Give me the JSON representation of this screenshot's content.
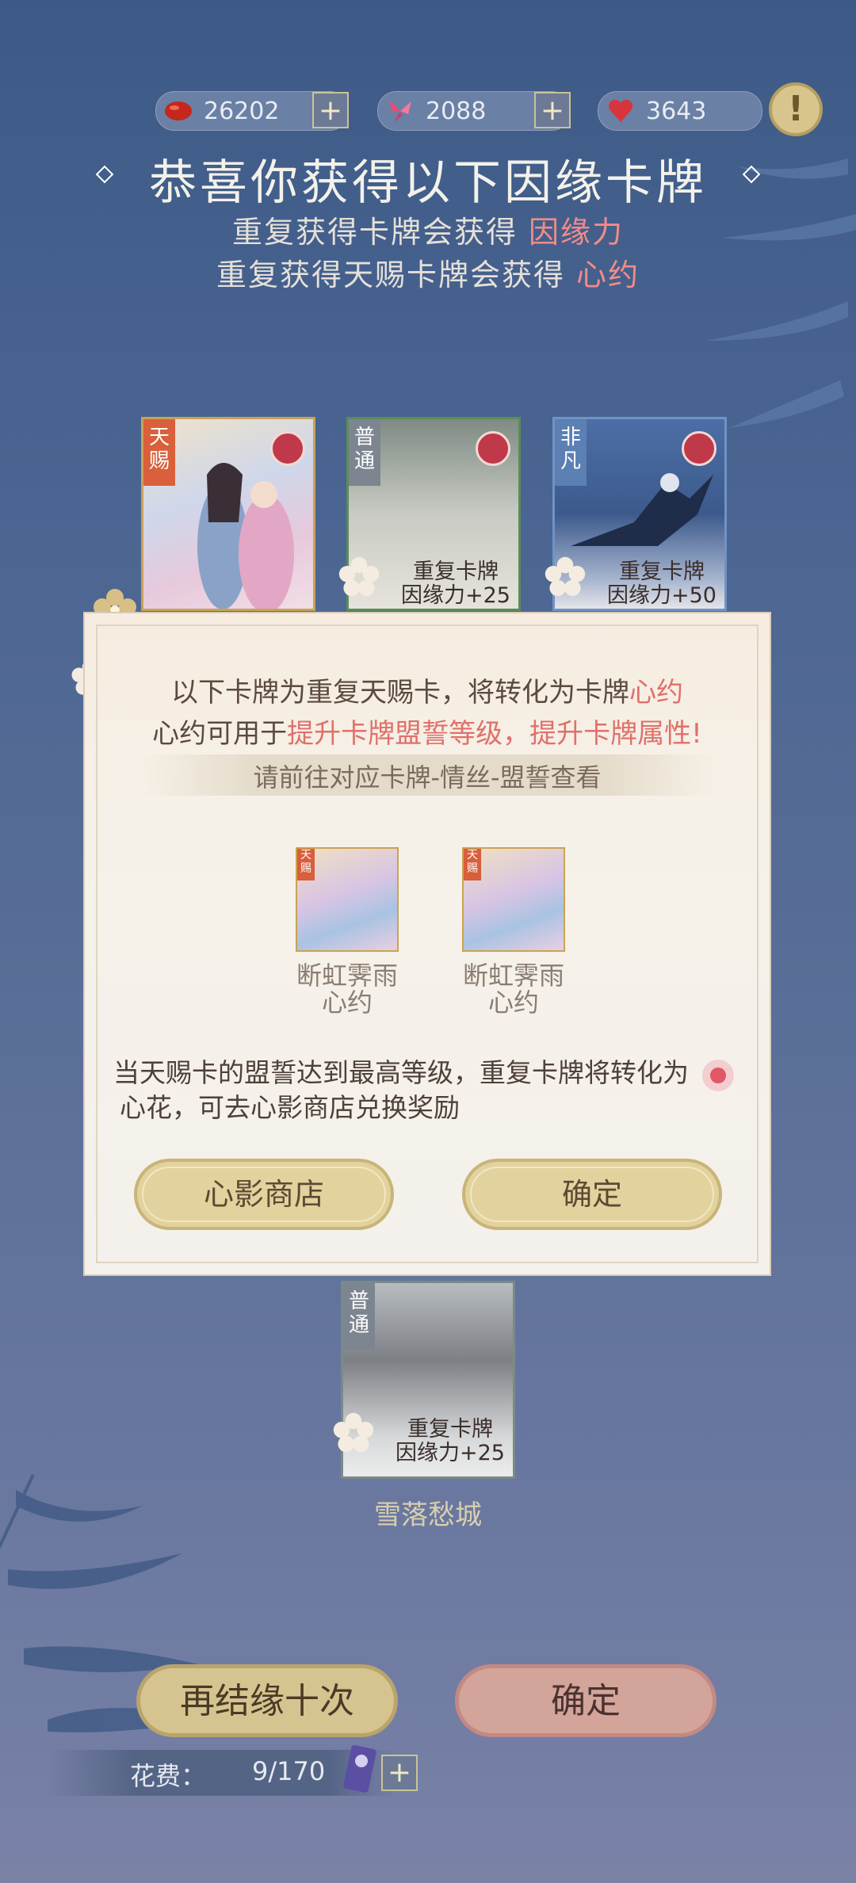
{
  "currency": [
    {
      "icon": "red-bean-icon",
      "value": "26202",
      "plus": "+"
    },
    {
      "icon": "butterfly-icon",
      "value": "2088",
      "plus": "+"
    },
    {
      "icon": "heart-icon",
      "value": "3643",
      "plus": "+"
    }
  ],
  "alert_icon": "!",
  "header": {
    "title": "恭喜你获得以下因缘卡牌",
    "line1_prefix": "重复获得卡牌会获得",
    "line1_highlight": "因缘力",
    "line2_prefix": "重复获得天赐卡牌会获得",
    "line2_highlight": "心约"
  },
  "cards": [
    {
      "rarity": "天赐",
      "color": "#d9603a"
    },
    {
      "rarity": "普通",
      "color": "#7d8590",
      "info1": "重复卡牌",
      "info2": "因缘力+25"
    },
    {
      "rarity": "非凡",
      "color": "#5c7fb4",
      "info1": "重复卡牌",
      "info2": "因缘力+50"
    },
    {
      "rarity": "普通",
      "color": "#7d8590",
      "info1": "重复卡牌",
      "info2": "因缘力+25",
      "name": "雪落愁城"
    }
  ],
  "modal": {
    "line1_prefix": "以下卡牌为重复天赐卡，将转化为卡牌",
    "line1_highlight": "心约",
    "line2_prefix": "心约可用于",
    "line2_highlight": "提升卡牌盟誓等级，提升卡牌属性!",
    "hint": "请前往对应卡牌-情丝-盟誓查看",
    "rewards": [
      {
        "tag": "天赐",
        "name": "断虹霁雨",
        "type": "心约"
      },
      {
        "tag": "天赐",
        "name": "断虹霁雨",
        "type": "心约"
      }
    ],
    "note_line1": "当天赐卡的盟誓达到最高等级，重复卡牌将转化为",
    "note_line2": "心花，可去心影商店兑换奖励",
    "btn_shop": "心影商店",
    "btn_confirm": "确定"
  },
  "bottom": {
    "retry": "再结缘十次",
    "confirm": "确定",
    "cost_label": "花费：",
    "cost_value": "9/170",
    "plus": "+"
  }
}
